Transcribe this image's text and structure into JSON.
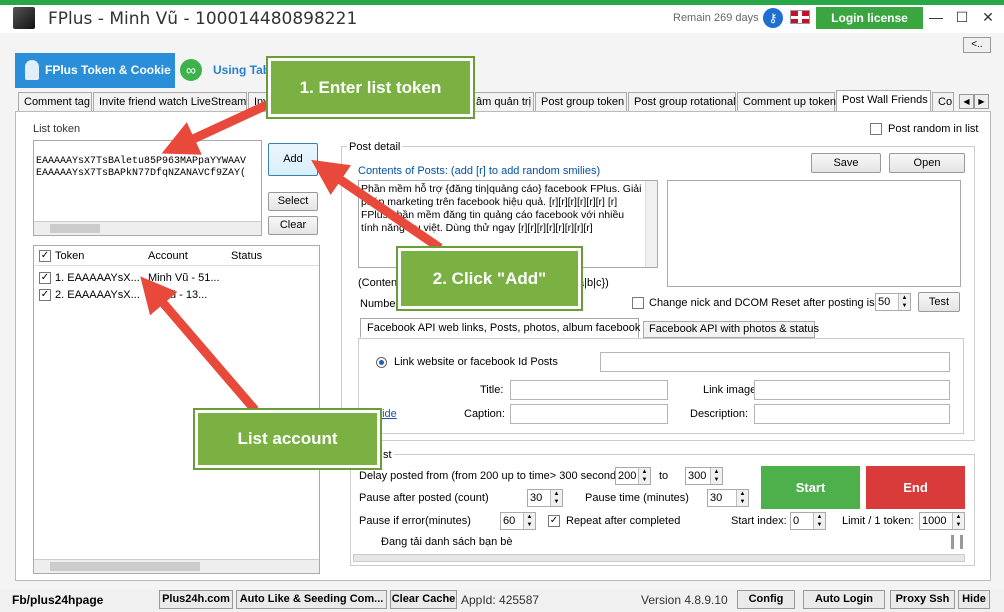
{
  "app": {
    "title": "FPlus - Minh Vũ - 100014480898221",
    "remain": "Remain 269 days",
    "login_license": "Login license",
    "minimize": "—",
    "maximize": "☐",
    "close": "✕",
    "collapse": "<.."
  },
  "main_tabs": {
    "tab1": "FPlus Token & Cookie",
    "tab2": "Using Tab"
  },
  "tabs": [
    "Comment tag",
    "Invite friend watch LiveStream",
    "Invi",
    "âm quản trị",
    "Post group token",
    "Post group rotational",
    "Comment up token",
    "Post Wall Friends",
    "Co"
  ],
  "left": {
    "list_token_label": "List token",
    "tokens": [
      "EAAAAAYsX7TsBAletu85P963MAPpaYYWAAV",
      "EAAAAAYsX7TsBAPkN77DfqNZANAVCf9ZAY("
    ],
    "add": "Add",
    "select": "Select",
    "clear": "Clear",
    "table": {
      "headers": [
        "Token",
        "Account",
        "Status"
      ],
      "rows": [
        {
          "token": "1. EAAAAAYsX...",
          "account": "Minh Vũ - 51..."
        },
        {
          "token": "2. EAAAAAYsX...",
          "account": "ủy Vũ - 13..."
        }
      ]
    }
  },
  "post": {
    "random_label": "Post random in list",
    "detail_label": "Post detail",
    "contents_label": "Contents of Posts: (add [r] to add random smilies)",
    "save": "Save",
    "open": "Open",
    "content_text": "Phần mềm hỗ trợ {đăng tin|quảng cáo} facebook FPlus. Giải pháp marketing trên facebook hiệu quả. [r][r][r][r][r][r] [r] FPlus phần mềm đăng tin quảng cáo facebook với nhiều tính năng ưu việt. Dùng thử ngay [r][r][r][r][r][r][r][r]",
    "content_note_left": "(Content",
    "content_note_right": "a|b|c})",
    "number_label": "Number",
    "change_nick": "Change nick and DCOM Reset after posting is",
    "change_value": "50",
    "test": "Test",
    "subtab1": "Facebook API web links, Posts, photos, album facebook",
    "subtab2": "Facebook API with photos & status",
    "radio_label": "Link website or facebook Id Posts",
    "title_label": "Title:",
    "link_image_label": "Link image",
    "guide": "uide",
    "caption_label": "Caption:",
    "description_label": "Description:"
  },
  "settings": {
    "group_label": "st",
    "delay_label": "Delay posted from (from 200 up to time> 300 seconds)",
    "delay_from": "200",
    "to": "to",
    "delay_to": "300",
    "pause_after_label": "Pause after posted (count)",
    "pause_after": "30",
    "pause_time_label": "Pause time (minutes)",
    "pause_time": "30",
    "pause_error_label": "Pause if error(minutes)",
    "pause_error": "60",
    "repeat_label": "Repeat after completed",
    "start_index_label": "Start index:",
    "start_index": "0",
    "limit_label": "Limit / 1 token:",
    "limit": "1000",
    "status_text": "Đang tải danh sách bạn bè",
    "start": "Start",
    "end": "End"
  },
  "overlays": {
    "enter": "1. Enter list token",
    "click": "2. Click \"Add\"",
    "list_account": "List account"
  },
  "statusbar": {
    "fb": "Fb/plus24hpage",
    "b1": "Plus24h.com",
    "b2": "Auto Like & Seeding Com...",
    "b3": "Clear Cache",
    "appid": "AppId: 425587",
    "version": "Version 4.8.9.10",
    "config": "Config",
    "autologin": "Auto Login",
    "proxy": "Proxy Ssh",
    "hide": "Hide"
  },
  "colors": {
    "accent_green": "#27a745",
    "tab_blue": "#2a8fd8",
    "start_green": "#4db04a",
    "end_red": "#d93b3b",
    "overlay_green": "#7ab142",
    "arrow_red": "#e8493b"
  }
}
